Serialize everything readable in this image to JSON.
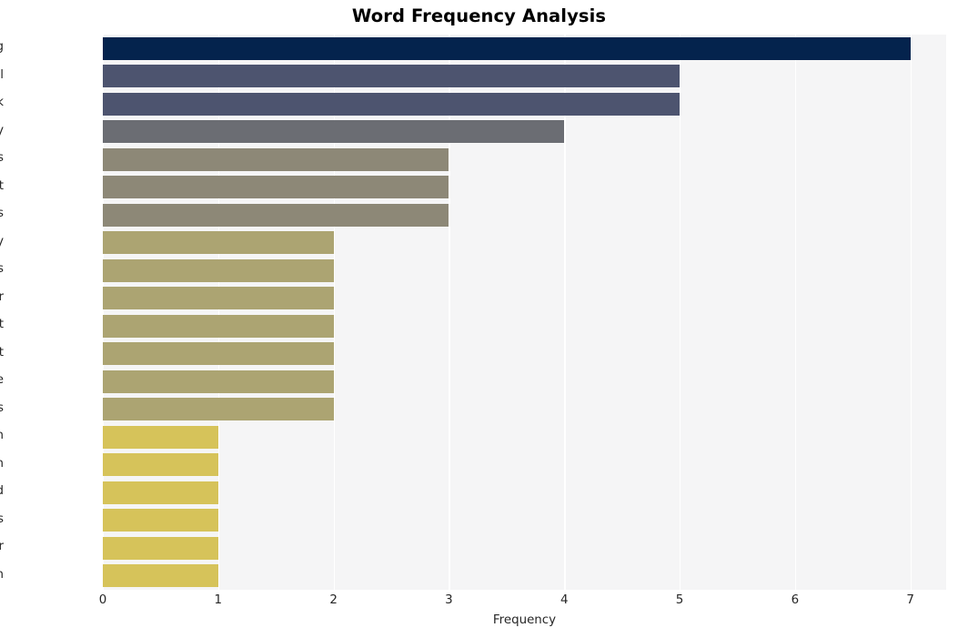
{
  "chart_data": {
    "type": "bar",
    "orientation": "horizontal",
    "title": "Word Frequency Analysis",
    "xlabel": "Frequency",
    "ylabel": "",
    "categories": [
      "phishing",
      "email",
      "attack",
      "security",
      "egress",
      "threat",
      "organizations",
      "cybersecurity",
      "previous",
      "year",
      "report",
      "account",
      "come",
      "deepfakes",
      "hash",
      "remain",
      "mind",
      "professionals",
      "cyber",
      "decision"
    ],
    "values": [
      7,
      5,
      5,
      4,
      3,
      3,
      3,
      2,
      2,
      2,
      2,
      2,
      2,
      2,
      1,
      1,
      1,
      1,
      1,
      1
    ],
    "bar_colors": [
      "#04234d",
      "#4d546f",
      "#4d546f",
      "#6b6d73",
      "#8d8877",
      "#8d8877",
      "#8d8877",
      "#aca472",
      "#aca472",
      "#aca472",
      "#aca472",
      "#aca472",
      "#aca472",
      "#aca472",
      "#d6c35a",
      "#d6c35a",
      "#d6c35a",
      "#d6c35a",
      "#d6c35a",
      "#d6c35a"
    ],
    "xlim": [
      0,
      7.31
    ],
    "xticks": [
      0,
      1,
      2,
      3,
      4,
      5,
      6,
      7
    ],
    "xtick_labels": [
      "0",
      "1",
      "2",
      "3",
      "4",
      "5",
      "6",
      "7"
    ],
    "grid": true,
    "grid_axis": "x",
    "grid_color": "#ffffff",
    "plot_background": "#f5f5f6",
    "figure_background": "#ffffff",
    "legend": null,
    "style": "whitegrid"
  }
}
